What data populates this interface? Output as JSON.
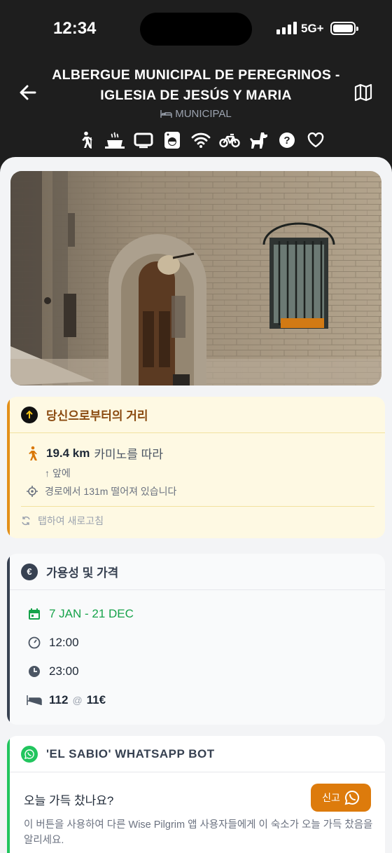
{
  "status_bar": {
    "time": "12:34",
    "network": "5G+"
  },
  "header": {
    "title": "ALBERGUE MUNICIPAL DE PEREGRINOS - IGLESIA DE JESÚS Y MARIA",
    "type": "MUNICIPAL",
    "amenities": [
      "pilgrim-icon",
      "kitchen-icon",
      "tv-icon",
      "washing-machine-icon",
      "wifi-icon",
      "bicycle-icon",
      "pets-icon",
      "help-icon",
      "favorite-icon"
    ]
  },
  "distance_card": {
    "title": "당신으로부터의 거리",
    "distance": "19.4 km",
    "distance_suffix": "카미노를 따라",
    "direction": "앞에",
    "offroute": "경로에서 131m 떨어져 있습니다",
    "refresh": "탭하여 새로고침"
  },
  "availability_card": {
    "title": "가용성 및 가격",
    "season": "7 JAN - 21 DEC",
    "open_time": "12:00",
    "close_time": "23:00",
    "beds": "112",
    "at": "@",
    "price": "11€"
  },
  "whatsapp_card": {
    "title": "'EL SABIO' WHATSAPP BOT",
    "question": "오늘 가득 찼나요?",
    "report_label": "신고",
    "description": "이 버튼을 사용하여 다른 Wise Pilgrim 앱 사용자들에게 이 숙소가 오늘 가득 찼음을 알리세요."
  },
  "colors": {
    "accent_orange": "#dd7b0c",
    "whatsapp_green": "#22c55e",
    "season_green": "#16a34a"
  }
}
